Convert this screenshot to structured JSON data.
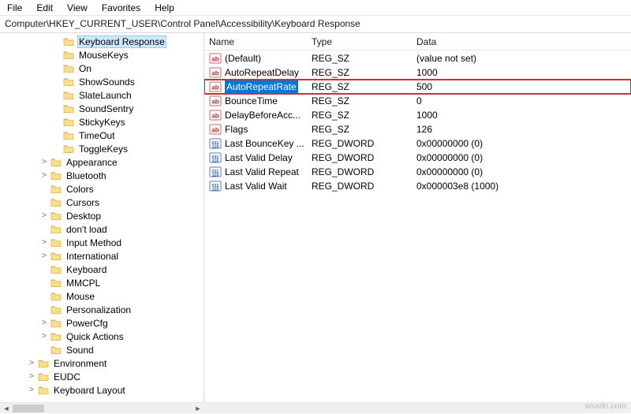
{
  "menu": [
    "File",
    "Edit",
    "View",
    "Favorites",
    "Help"
  ],
  "address": "Computer\\HKEY_CURRENT_USER\\Control Panel\\Accessibility\\Keyboard Response",
  "tree": [
    {
      "depth": 4,
      "chev": "",
      "label": "Keyboard Response",
      "selected": true
    },
    {
      "depth": 4,
      "chev": "",
      "label": "MouseKeys"
    },
    {
      "depth": 4,
      "chev": "",
      "label": "On"
    },
    {
      "depth": 4,
      "chev": "",
      "label": "ShowSounds"
    },
    {
      "depth": 4,
      "chev": "",
      "label": "SlateLaunch"
    },
    {
      "depth": 4,
      "chev": "",
      "label": "SoundSentry"
    },
    {
      "depth": 4,
      "chev": "",
      "label": "StickyKeys"
    },
    {
      "depth": 4,
      "chev": "",
      "label": "TimeOut"
    },
    {
      "depth": 4,
      "chev": "",
      "label": "ToggleKeys"
    },
    {
      "depth": 3,
      "chev": ">",
      "label": "Appearance"
    },
    {
      "depth": 3,
      "chev": ">",
      "label": "Bluetooth"
    },
    {
      "depth": 3,
      "chev": "",
      "label": "Colors"
    },
    {
      "depth": 3,
      "chev": "",
      "label": "Cursors"
    },
    {
      "depth": 3,
      "chev": ">",
      "label": "Desktop"
    },
    {
      "depth": 3,
      "chev": "",
      "label": "don't load"
    },
    {
      "depth": 3,
      "chev": ">",
      "label": "Input Method"
    },
    {
      "depth": 3,
      "chev": ">",
      "label": "International"
    },
    {
      "depth": 3,
      "chev": "",
      "label": "Keyboard"
    },
    {
      "depth": 3,
      "chev": "",
      "label": "MMCPL"
    },
    {
      "depth": 3,
      "chev": "",
      "label": "Mouse"
    },
    {
      "depth": 3,
      "chev": "",
      "label": "Personalization"
    },
    {
      "depth": 3,
      "chev": ">",
      "label": "PowerCfg"
    },
    {
      "depth": 3,
      "chev": ">",
      "label": "Quick Actions"
    },
    {
      "depth": 3,
      "chev": "",
      "label": "Sound"
    },
    {
      "depth": 2,
      "chev": ">",
      "label": "Environment"
    },
    {
      "depth": 2,
      "chev": ">",
      "label": "EUDC"
    },
    {
      "depth": 2,
      "chev": ">",
      "label": "Keyboard Layout"
    }
  ],
  "columns": {
    "name": "Name",
    "type": "Type",
    "data": "Data"
  },
  "values": [
    {
      "icon": "sz",
      "name": "(Default)",
      "type": "REG_SZ",
      "data": "(value not set)"
    },
    {
      "icon": "sz",
      "name": "AutoRepeatDelay",
      "type": "REG_SZ",
      "data": "1000"
    },
    {
      "icon": "sz",
      "name": "AutoRepeatRate",
      "type": "REG_SZ",
      "data": "500",
      "selected": true,
      "highlighted": true
    },
    {
      "icon": "sz",
      "name": "BounceTime",
      "type": "REG_SZ",
      "data": "0"
    },
    {
      "icon": "sz",
      "name": "DelayBeforeAcc...",
      "type": "REG_SZ",
      "data": "1000"
    },
    {
      "icon": "sz",
      "name": "Flags",
      "type": "REG_SZ",
      "data": "126"
    },
    {
      "icon": "dw",
      "name": "Last BounceKey ...",
      "type": "REG_DWORD",
      "data": "0x00000000 (0)"
    },
    {
      "icon": "dw",
      "name": "Last Valid Delay",
      "type": "REG_DWORD",
      "data": "0x00000000 (0)"
    },
    {
      "icon": "dw",
      "name": "Last Valid Repeat",
      "type": "REG_DWORD",
      "data": "0x00000000 (0)"
    },
    {
      "icon": "dw",
      "name": "Last Valid Wait",
      "type": "REG_DWORD",
      "data": "0x000003e8 (1000)"
    }
  ],
  "watermark": "wsxdn.com"
}
